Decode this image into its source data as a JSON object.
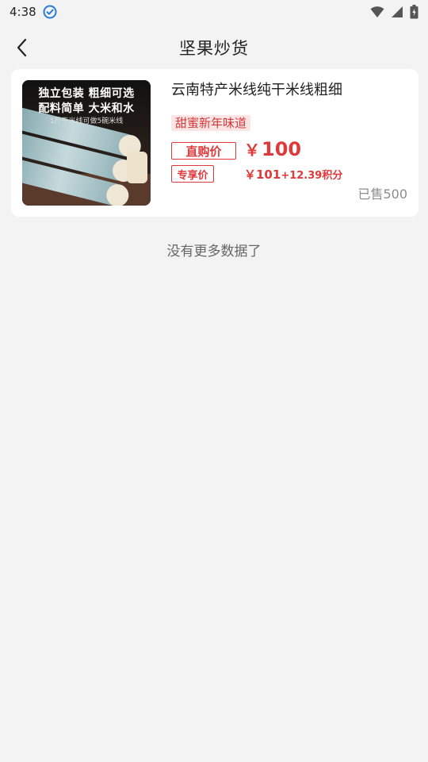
{
  "status_bar": {
    "time": "4:38"
  },
  "header": {
    "title": "坚果炒货"
  },
  "product": {
    "name": "云南特产米线纯干米线粗细",
    "image_text": {
      "line1": "独立包装 粗细可选",
      "line2": "配料简单 大米和水",
      "line3": "1斤干米线可做5碗米线"
    },
    "promo_tag": "甜蜜新年味道",
    "direct_label": "直购价",
    "price_currency": "￥",
    "price_value": "100",
    "exclusive_label": "专享价",
    "exclusive_price": "￥101",
    "exclusive_points": "+12.39积分",
    "sold": "已售500"
  },
  "footer": {
    "no_more": "没有更多数据了"
  },
  "colors": {
    "accent_red": "#e0393b",
    "background": "#f3f3f3"
  }
}
